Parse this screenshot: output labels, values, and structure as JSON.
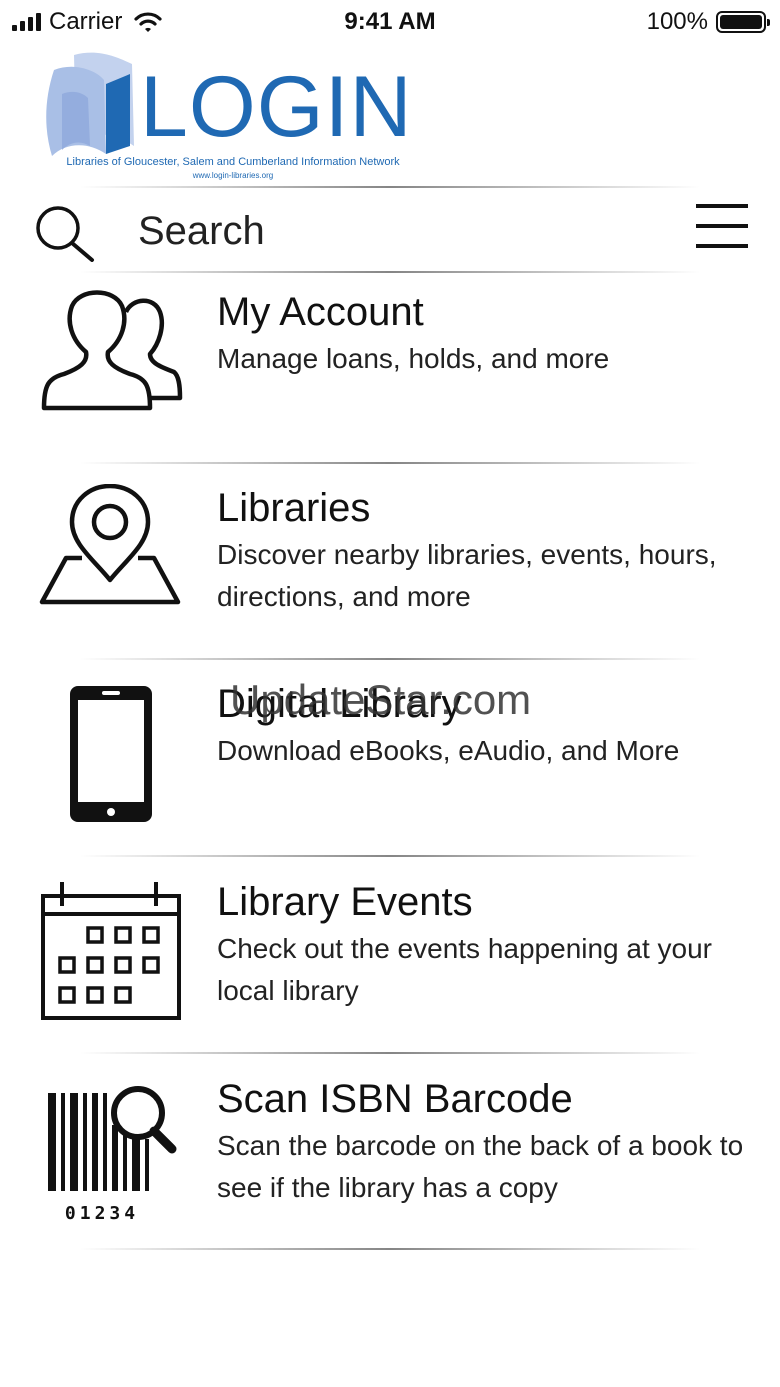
{
  "status_bar": {
    "carrier": "Carrier",
    "time": "9:41 AM",
    "battery": "100%"
  },
  "logo": {
    "word": "LOGIN",
    "subtitle": "Libraries of Gloucester, Salem and Cumberland Information Network",
    "url": "www.login-libraries.org",
    "color": "#1f69b3"
  },
  "search": {
    "placeholder": "Search"
  },
  "menu": [
    {
      "title": "My Account",
      "description": "Manage loans, holds, and more",
      "icon": "users-icon"
    },
    {
      "title": "Libraries",
      "description": "Discover nearby libraries, events, hours, directions, and more",
      "icon": "map-pin-icon"
    },
    {
      "title": "Digital Library",
      "description": "Download eBooks, eAudio, and More",
      "icon": "smartphone-icon"
    },
    {
      "title": "Library Events",
      "description": "Check out the events happening at your local library",
      "icon": "calendar-icon"
    },
    {
      "title": "Scan ISBN Barcode",
      "description": "Scan the barcode on the back of a book to see if the library has a copy",
      "icon": "barcode-scan-icon",
      "barcode_digits": "01234"
    }
  ],
  "watermark": "UpdateStar.com"
}
